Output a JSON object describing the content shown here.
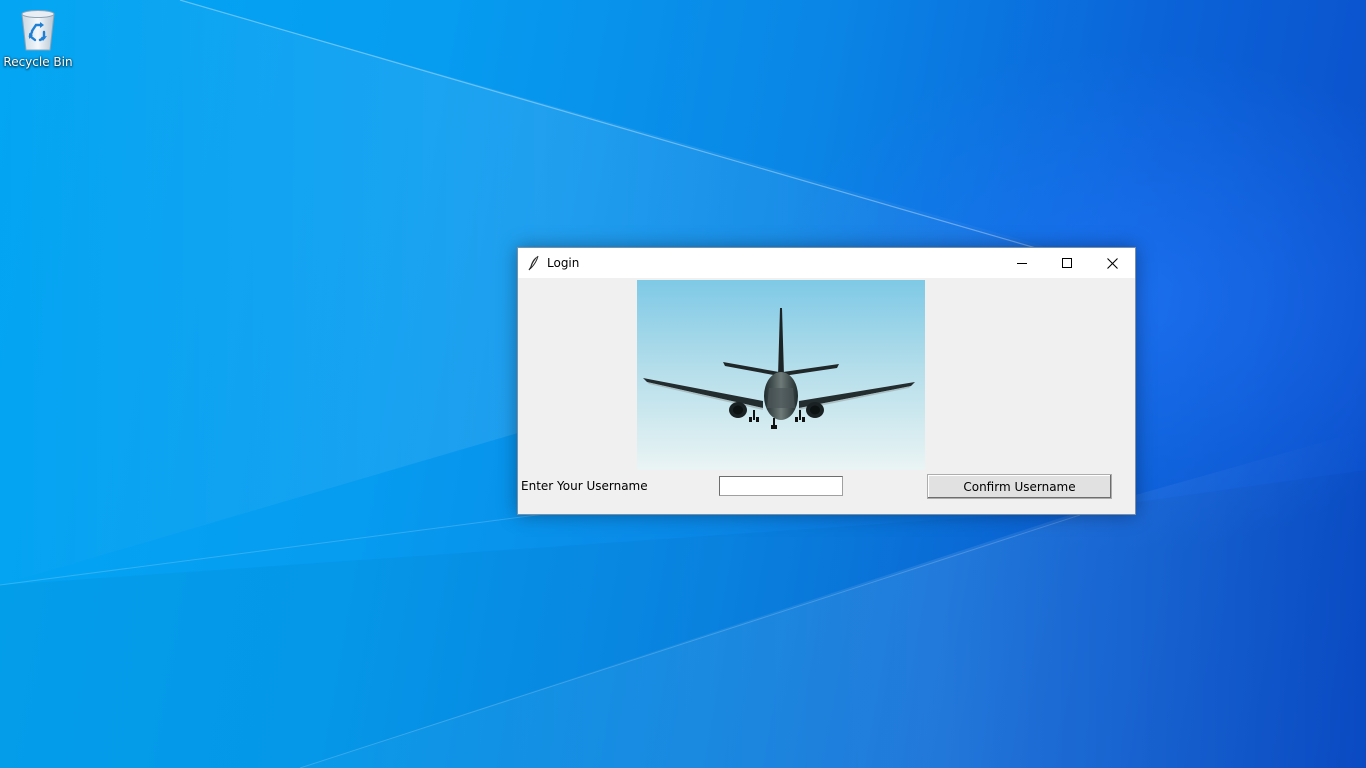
{
  "desktop": {
    "icons": [
      {
        "label": "Recycle Bin",
        "icon": "recycle-bin-icon"
      }
    ]
  },
  "window": {
    "title": "Login",
    "app_icon": "feather-icon",
    "controls": {
      "minimize": "minimize-icon",
      "maximize": "maximize-icon",
      "close": "close-icon"
    }
  },
  "form": {
    "image": "airplane-photo",
    "username_label": "Enter Your Username",
    "username_value": "",
    "confirm_button_label": "Confirm Username"
  },
  "colors": {
    "desktop_light": "#03a6f3",
    "desktop_dark": "#0b4cc9",
    "window_bg": "#f0f0f0",
    "titlebar_bg": "#ffffff"
  }
}
